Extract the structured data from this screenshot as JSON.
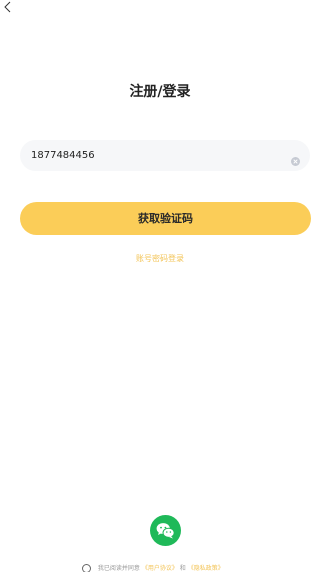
{
  "nav": {
    "back_icon": "chevron-left-icon"
  },
  "title": "注册/登录",
  "phone": {
    "value": "1877484456",
    "clear_icon": "clear-circle-icon"
  },
  "get_code_label": "获取验证码",
  "password_login_label": "账号密码登录",
  "wechat": {
    "icon": "wechat-icon",
    "color": "#1fb959"
  },
  "agreement": {
    "prefix": "我已阅读并同意",
    "user_agreement": "《用户协议》",
    "and": "和",
    "privacy_policy": "《隐私政策》"
  },
  "colors": {
    "accent": "#fbcd58",
    "link": "#f3c457"
  }
}
